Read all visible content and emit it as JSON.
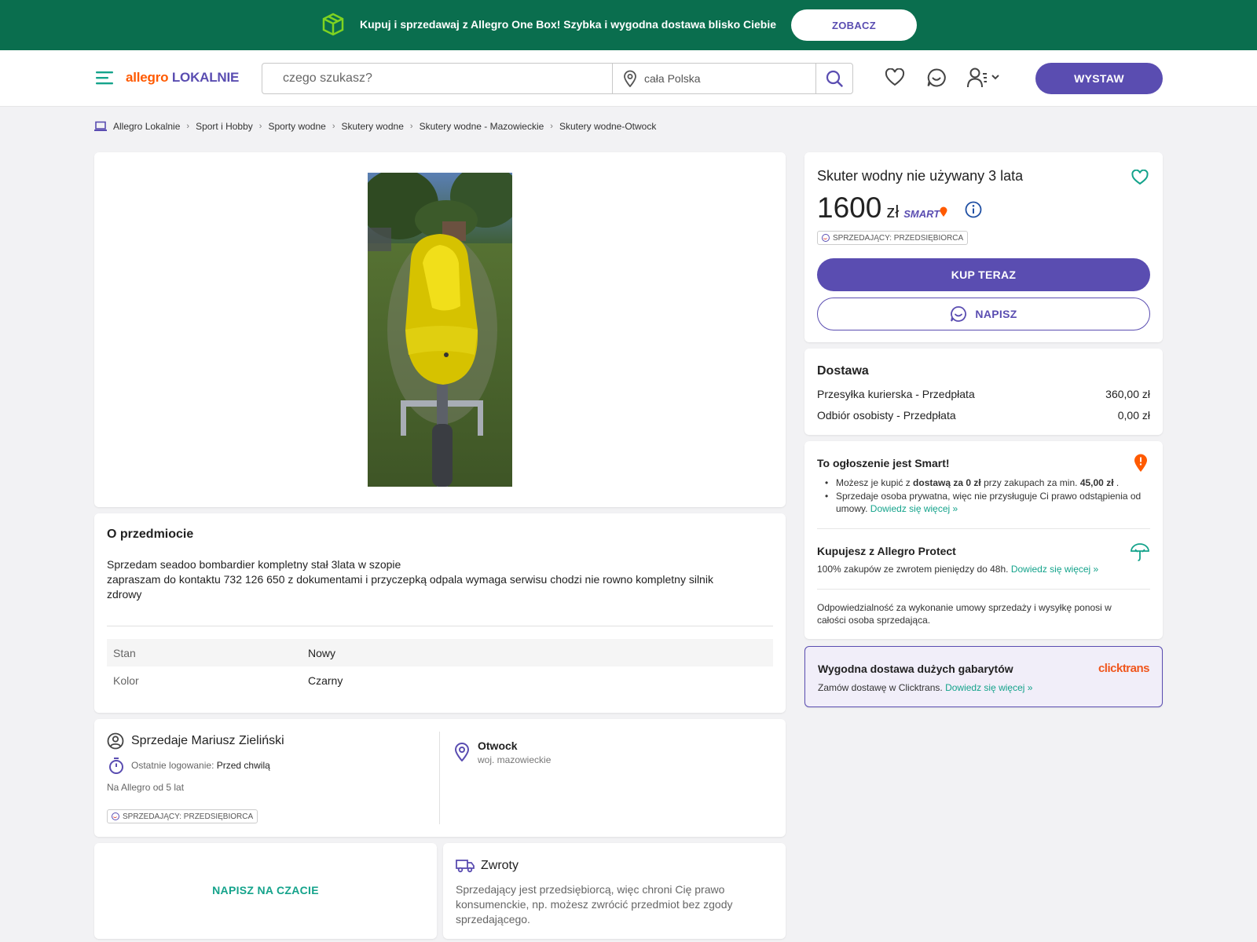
{
  "promo": {
    "text": "Kupuj i sprzedawaj z Allegro One Box! Szybka i wygodna dostawa blisko Ciebie",
    "button": "ZOBACZ"
  },
  "header": {
    "logo_part1": "allegro",
    "logo_part2": "LOKALNIE",
    "search_placeholder": "czego szukasz?",
    "location_placeholder": "cała Polska",
    "post_button": "WYSTAW"
  },
  "breadcrumb": [
    "Allegro Lokalnie",
    "Sport i Hobby",
    "Sporty wodne",
    "Skutery wodne",
    "Skutery wodne - Mazowieckie",
    "Skutery wodne-Otwock"
  ],
  "about": {
    "title": "O przedmiocie",
    "line1": "Sprzedam seadoo bombardier kompletny stał 3lata w szopie",
    "line2": "zapraszam do kontaktu 732 126 650 z dokumentami i przyczepką odpala wymaga serwisu chodzi nie rowno kompletny silnik zdrowy",
    "params": [
      {
        "key": "Stan",
        "value": "Nowy"
      },
      {
        "key": "Kolor",
        "value": "Czarny"
      }
    ]
  },
  "seller": {
    "title": "Sprzedaje Mariusz Zieliński",
    "last_login_label": "Ostatnie logowanie:",
    "last_login_value": "Przed chwilą",
    "since": "Na Allegro od 5 lat",
    "badge": "SPRZEDAJĄCY: PRZEDSIĘBIORCA",
    "city": "Otwock",
    "region": "woj. mazowieckie"
  },
  "chat": {
    "button": "NAPISZ NA CZACIE"
  },
  "returns": {
    "title": "Zwroty",
    "text": "Sprzedający jest przedsiębiorcą, więc chroni Cię prawo konsumenckie, np. możesz zwrócić przedmiot bez zgody sprzedającego."
  },
  "offer": {
    "title": "Skuter wodny nie używany 3 lata",
    "price": "1600",
    "currency": "zł",
    "smart": "SMART",
    "badge": "SPRZEDAJĄCY: PRZEDSIĘBIORCA",
    "buy_button": "KUP TERAZ",
    "message_button": "NAPISZ"
  },
  "delivery": {
    "title": "Dostawa",
    "options": [
      {
        "name": "Przesyłka kurierska - Przedpłata",
        "price": "360,00 zł"
      },
      {
        "name": "Odbiór osobisty - Przedpłata",
        "price": "0,00 zł"
      }
    ]
  },
  "smart_info": {
    "title": "To ogłoszenie jest Smart!",
    "b1_pre": "Możesz je kupić z",
    "b1_bold": "dostawą za 0 zł",
    "b1_mid": "przy zakupach za min.",
    "b1_amount": "45,00 zł",
    "b1_end": ".",
    "b2": "Sprzedaje osoba prywatna, więc nie przysługuje Ci prawo odstąpienia od umowy.",
    "b2_link": "Dowiedz się więcej »",
    "protect_title": "Kupujesz z Allegro Protect",
    "protect_text": "100% zakupów ze zwrotem pieniędzy do 48h.",
    "protect_link": "Dowiedz się więcej »",
    "responsibility": "Odpowiedzialność za wykonanie umowy sprzedaży i wysyłkę ponosi w całości osoba sprzedająca."
  },
  "clicktrans": {
    "title": "Wygodna dostawa dużych gabarytów",
    "logo": "clicktrans",
    "text": "Zamów dostawę w Clicktrans.",
    "link": "Dowiedz się więcej »"
  },
  "colors": {
    "brand_purple": "#5a4db1",
    "promo_green": "#0a6e4e",
    "allegro_orange": "#ff5a00",
    "link_teal": "#14a38b"
  }
}
